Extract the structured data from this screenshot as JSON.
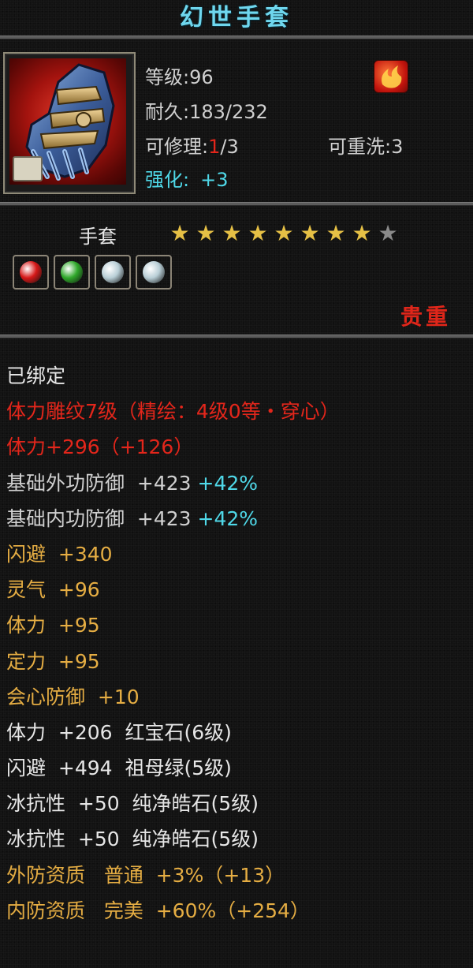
{
  "title": "幻世手套",
  "item": {
    "level_label": "等级:96",
    "durability_label": "耐久:",
    "durability_value": "183/232",
    "repair_label": "可修理:",
    "repair_current": "1",
    "repair_total": "/3",
    "rewash_label": "可重洗:3",
    "enhance_label": "强化:",
    "enhance_value": "+3"
  },
  "type_label": "手套",
  "stars": {
    "filled": 8,
    "total": 9
  },
  "gems": [
    {
      "icon": "red-gem-icon",
      "color": "#d61818"
    },
    {
      "icon": "green-gem-icon",
      "color": "#2fa82a"
    },
    {
      "icon": "white-gem-icon",
      "color": "#b8ced6"
    },
    {
      "icon": "white-gem-icon",
      "color": "#b8ced6"
    }
  ],
  "rarity_text": "贵重",
  "bound_status": "已绑定",
  "attributes": [
    {
      "parts": [
        {
          "text": "体力雕纹7级（精绘：4级0等・穿心）",
          "color": "red"
        }
      ]
    },
    {
      "parts": [
        {
          "text": "体力+296（+126）",
          "color": "red"
        }
      ]
    },
    {
      "parts": [
        {
          "text": "基础外功防御  +423 ",
          "color": "gray"
        },
        {
          "text": "+42%",
          "color": "cyan"
        }
      ]
    },
    {
      "parts": [
        {
          "text": "基础内功防御  +423 ",
          "color": "gray"
        },
        {
          "text": "+42%",
          "color": "cyan"
        }
      ]
    },
    {
      "parts": [
        {
          "text": "闪避  +340",
          "color": "orange"
        }
      ]
    },
    {
      "parts": [
        {
          "text": "灵气  +96",
          "color": "orange"
        }
      ]
    },
    {
      "parts": [
        {
          "text": "体力  +95",
          "color": "orange"
        }
      ]
    },
    {
      "parts": [
        {
          "text": "定力  +95",
          "color": "orange"
        }
      ]
    },
    {
      "parts": [
        {
          "text": "会心防御  +10",
          "color": "orange"
        }
      ]
    },
    {
      "parts": [
        {
          "text": "体力  +206  红宝石(6级)",
          "color": "white"
        }
      ]
    },
    {
      "parts": [
        {
          "text": "闪避  +494  祖母绿(5级)",
          "color": "white"
        }
      ]
    },
    {
      "parts": [
        {
          "text": "冰抗性  +50  纯净皓石(5级)",
          "color": "white"
        }
      ]
    },
    {
      "parts": [
        {
          "text": "冰抗性  +50  纯净皓石(5级)",
          "color": "white"
        }
      ]
    },
    {
      "parts": [
        {
          "text": "外防资质   普通  +3%（+13）",
          "color": "orange"
        }
      ]
    },
    {
      "parts": [
        {
          "text": "内防资质   完美  +60%（+254）",
          "color": "orange"
        }
      ]
    }
  ]
}
